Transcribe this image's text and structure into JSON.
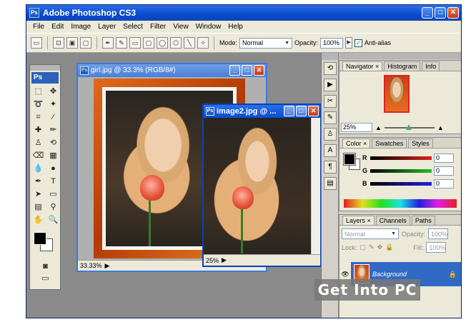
{
  "app": {
    "title": "Adobe Photoshop CS3",
    "logo": "Ps"
  },
  "window_buttons": [
    "_",
    "□",
    "✕"
  ],
  "menu": [
    "File",
    "Edit",
    "Image",
    "Layer",
    "Select",
    "Filter",
    "View",
    "Window",
    "Help"
  ],
  "options": {
    "mode_label": "Mode:",
    "mode_value": "Normal",
    "opacity_label": "Opacity:",
    "opacity_value": "100%",
    "antialias_label": "Anti-alias"
  },
  "toolbox": {
    "logo": "Ps"
  },
  "doc1": {
    "title": "girl.jpg @ 33.3% (RGB/8#)",
    "zoom": "33.33%"
  },
  "doc2": {
    "title": "image2.jpg @ ...",
    "zoom": "25%"
  },
  "navigator": {
    "tabs": [
      "Navigator ×",
      "Histogram",
      "Info"
    ],
    "zoom": "25%"
  },
  "color": {
    "tabs": [
      "Color ×",
      "Swatches",
      "Styles"
    ],
    "channels": [
      {
        "label": "R",
        "value": "0",
        "color": "#e02020"
      },
      {
        "label": "G",
        "value": "0",
        "color": "#20a020"
      },
      {
        "label": "B",
        "value": "0",
        "color": "#2020e0"
      }
    ]
  },
  "layers": {
    "tabs": [
      "Layers ×",
      "Channels",
      "Paths"
    ],
    "blend_mode": "Normal",
    "opacity_label": "Opacity:",
    "opacity_value": "100%",
    "lock_label": "Lock:",
    "fill_label": "Fill:",
    "fill_value": "100%",
    "layer_name": "Background"
  },
  "watermark": "Get Into PC"
}
